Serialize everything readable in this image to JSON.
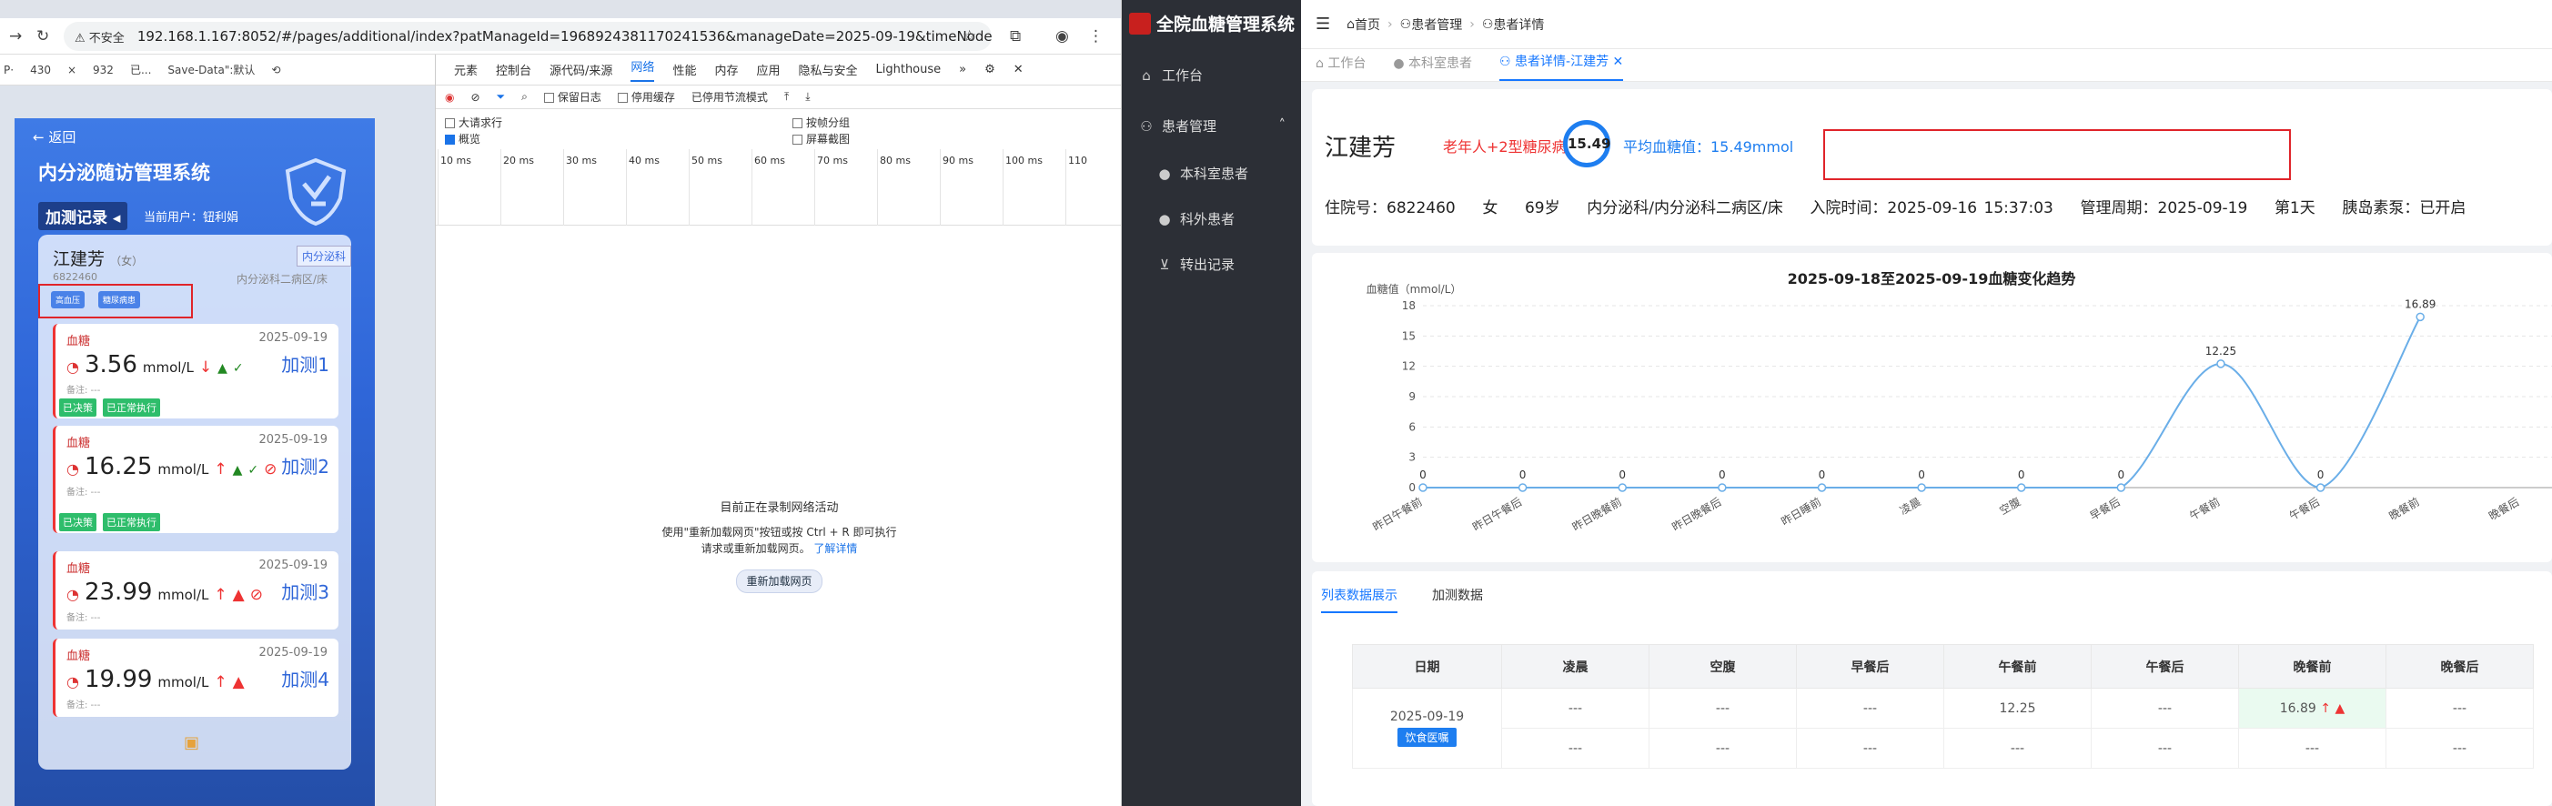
{
  "browser": {
    "security_label": "不安全",
    "url": "192.168.1.167:8052/#/pages/additional/index?patManageId=1968924381170241536&manageDate=2025-09-19&timeNode=60"
  },
  "device_toolbar": {
    "dim_w": "430",
    "dim_x": "×",
    "dim_h": "932",
    "zoom": "Save-Data\":默认",
    "mode": "已..."
  },
  "mobile": {
    "back_label": "返回",
    "system_title": "内分泌随访管理系统",
    "record_label": "加测记录",
    "current_user": "当前用户：钮利娟",
    "patient": {
      "name": "江建芳",
      "sex": "（女）",
      "id": "6822460",
      "dept_tag": "内分泌科",
      "ward": "内分泌科二病区/床",
      "tags": [
        "高血压",
        "糖尿病患"
      ]
    },
    "entries": [
      {
        "type": "血糖",
        "date": "2025-09-19",
        "value": "3.56",
        "unit": "mmol/L",
        "arrow": "↓",
        "add": "加测1",
        "note": "备注: ---",
        "status": [
          "已决策",
          "已正常执行"
        ]
      },
      {
        "type": "血糖",
        "date": "2025-09-19",
        "value": "16.25",
        "unit": "mmol/L",
        "arrow": "↑",
        "add": "加测2",
        "note": "备注: ---",
        "status": [
          "已决策",
          "已正常执行"
        ]
      },
      {
        "type": "血糖",
        "date": "2025-09-19",
        "value": "23.99",
        "unit": "mmol/L",
        "arrow": "↑",
        "add": "加测3",
        "note": "备注: ---"
      },
      {
        "type": "血糖",
        "date": "2025-09-19",
        "value": "19.99",
        "unit": "mmol/L",
        "arrow": "↑",
        "add": "加测4",
        "note": "备注: ---"
      }
    ]
  },
  "devtools": {
    "tabs": [
      "元素",
      "控制台",
      "源代码/来源",
      "网络",
      "性能",
      "内存",
      "应用",
      "隐私与安全",
      "Lighthouse"
    ],
    "active_tab": "网络",
    "net_toolbar": {
      "preserve_log": "保留日志",
      "disable_cache": "停用缓存",
      "throttle": "已停用节流模式"
    },
    "options": {
      "big_rows": "大请求行",
      "group_by_frame": "按帧分组",
      "overview": "概览",
      "screenshots": "屏幕截图"
    },
    "ticks": [
      "10 ms",
      "20 ms",
      "30 ms",
      "40 ms",
      "50 ms",
      "60 ms",
      "70 ms",
      "80 ms",
      "90 ms",
      "100 ms",
      "110"
    ],
    "empty_title": "目前正在录制网络活动",
    "empty_hint_1": "使用\"重新加载网页\"按钮或按 Ctrl + R 即可执行",
    "empty_hint_2": "请求或重新加载网页。",
    "learn_more": "了解详情",
    "reload_button": "重新加载网页"
  },
  "sidebar": {
    "brand": "全院血糖管理系统",
    "items": [
      {
        "label": "工作台",
        "icon": "home-icon"
      },
      {
        "label": "患者管理",
        "icon": "patients-icon"
      },
      {
        "label": "本科室患者",
        "icon": "user-icon"
      },
      {
        "label": "科外患者",
        "icon": "user-icon"
      },
      {
        "label": "转出记录",
        "icon": "cart-icon"
      }
    ]
  },
  "app": {
    "breadcrumb": [
      "首页",
      "患者管理",
      "患者详情"
    ],
    "tabs": [
      "工作台",
      "本科室患者",
      "患者详情-江建芳"
    ],
    "patient": {
      "name": "江建芳",
      "conditions": "老年人+2型糖尿病",
      "avg_glucose_badge": "15.49",
      "avg_glucose_text": "平均血糖值：15.49mmol",
      "inpatient_no": "住院号：6822460",
      "sex": "女",
      "age": "69岁",
      "ward": "内分泌科/内分泌科二病区/床",
      "admit_time": "入院时间：2025-09-16 15:37:03",
      "manage_cycle": "管理周期：2025-09-19",
      "day": "第1天",
      "insulin_pump": "胰岛素泵：已开启"
    },
    "table_tabs": [
      "列表数据展示",
      "加测数据"
    ],
    "table": {
      "headers": [
        "日期",
        "凌晨",
        "空腹",
        "早餐后",
        "午餐前",
        "午餐后",
        "晚餐前",
        "晚餐后"
      ],
      "date": "2025-09-19",
      "diet_button": "饮食医嘱",
      "row1": [
        "---",
        "---",
        "---",
        "12.25",
        "---",
        "16.89",
        "---"
      ],
      "row2": [
        "---",
        "---",
        "---",
        "---",
        "---",
        "---",
        "---"
      ]
    }
  },
  "colors": {
    "accent": "#1677ff",
    "danger": "#e33333",
    "sidebar": "#2c2f36",
    "chart_line": "#6aaee8"
  },
  "chart_data": {
    "type": "line",
    "title": "2025-09-18至2025-09-19血糖变化趋势",
    "ylabel": "血糖值（mmol/L）",
    "ylim": [
      0,
      18
    ],
    "yticks": [
      0,
      3,
      6,
      9,
      12,
      15,
      18
    ],
    "categories": [
      "昨日午餐前",
      "昨日午餐后",
      "昨日晚餐前",
      "昨日晚餐后",
      "昨日睡前",
      "凌晨",
      "空腹",
      "早餐后",
      "午餐前",
      "午餐后",
      "晚餐前",
      "晚餐后"
    ],
    "values": [
      0,
      0,
      0,
      0,
      0,
      0,
      0,
      0,
      12.25,
      0,
      16.89,
      null
    ],
    "labels": [
      "0",
      "0",
      "0",
      "0",
      "0",
      "0",
      "0",
      "0",
      "12.25",
      "0",
      "16.89",
      ""
    ],
    "grid": "horizontal"
  }
}
